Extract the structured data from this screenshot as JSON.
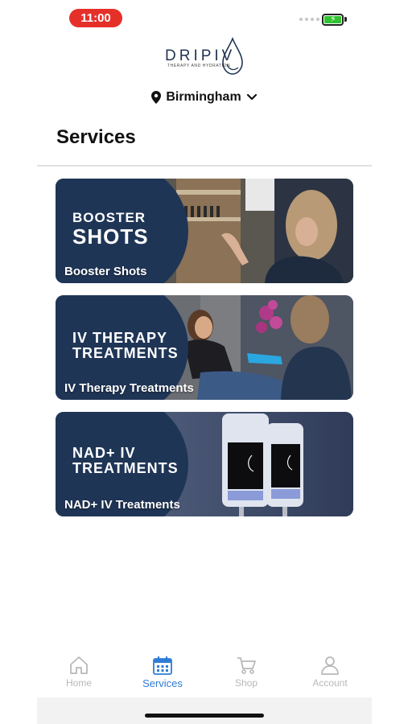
{
  "status_bar": {
    "time": "11:00"
  },
  "logo": {
    "name": "DRIPIV",
    "tagline": "THERAPY AND HYDRATION"
  },
  "location": {
    "label": "Birmingham"
  },
  "page": {
    "title": "Services"
  },
  "services": [
    {
      "headline_line1": "BOOSTER",
      "headline_line2": "SHOTS",
      "label": "Booster Shots"
    },
    {
      "headline_line1": "IV THERAPY",
      "headline_line2": "TREATMENTS",
      "label": "IV Therapy Treatments"
    },
    {
      "headline_line1": "NAD+ IV",
      "headline_line2": "TREATMENTS",
      "label": "NAD+ IV Treatments"
    }
  ],
  "tabs": [
    {
      "label": "Home",
      "icon": "home-icon",
      "active": false
    },
    {
      "label": "Services",
      "icon": "calendar-icon",
      "active": true
    },
    {
      "label": "Shop",
      "icon": "cart-icon",
      "active": false
    },
    {
      "label": "Account",
      "icon": "user-icon",
      "active": false
    }
  ],
  "colors": {
    "brand_navy": "#1f3556",
    "active_tab": "#2f7cd6",
    "inactive_tab": "#b8b8b8",
    "status_pill": "#e5302a"
  }
}
